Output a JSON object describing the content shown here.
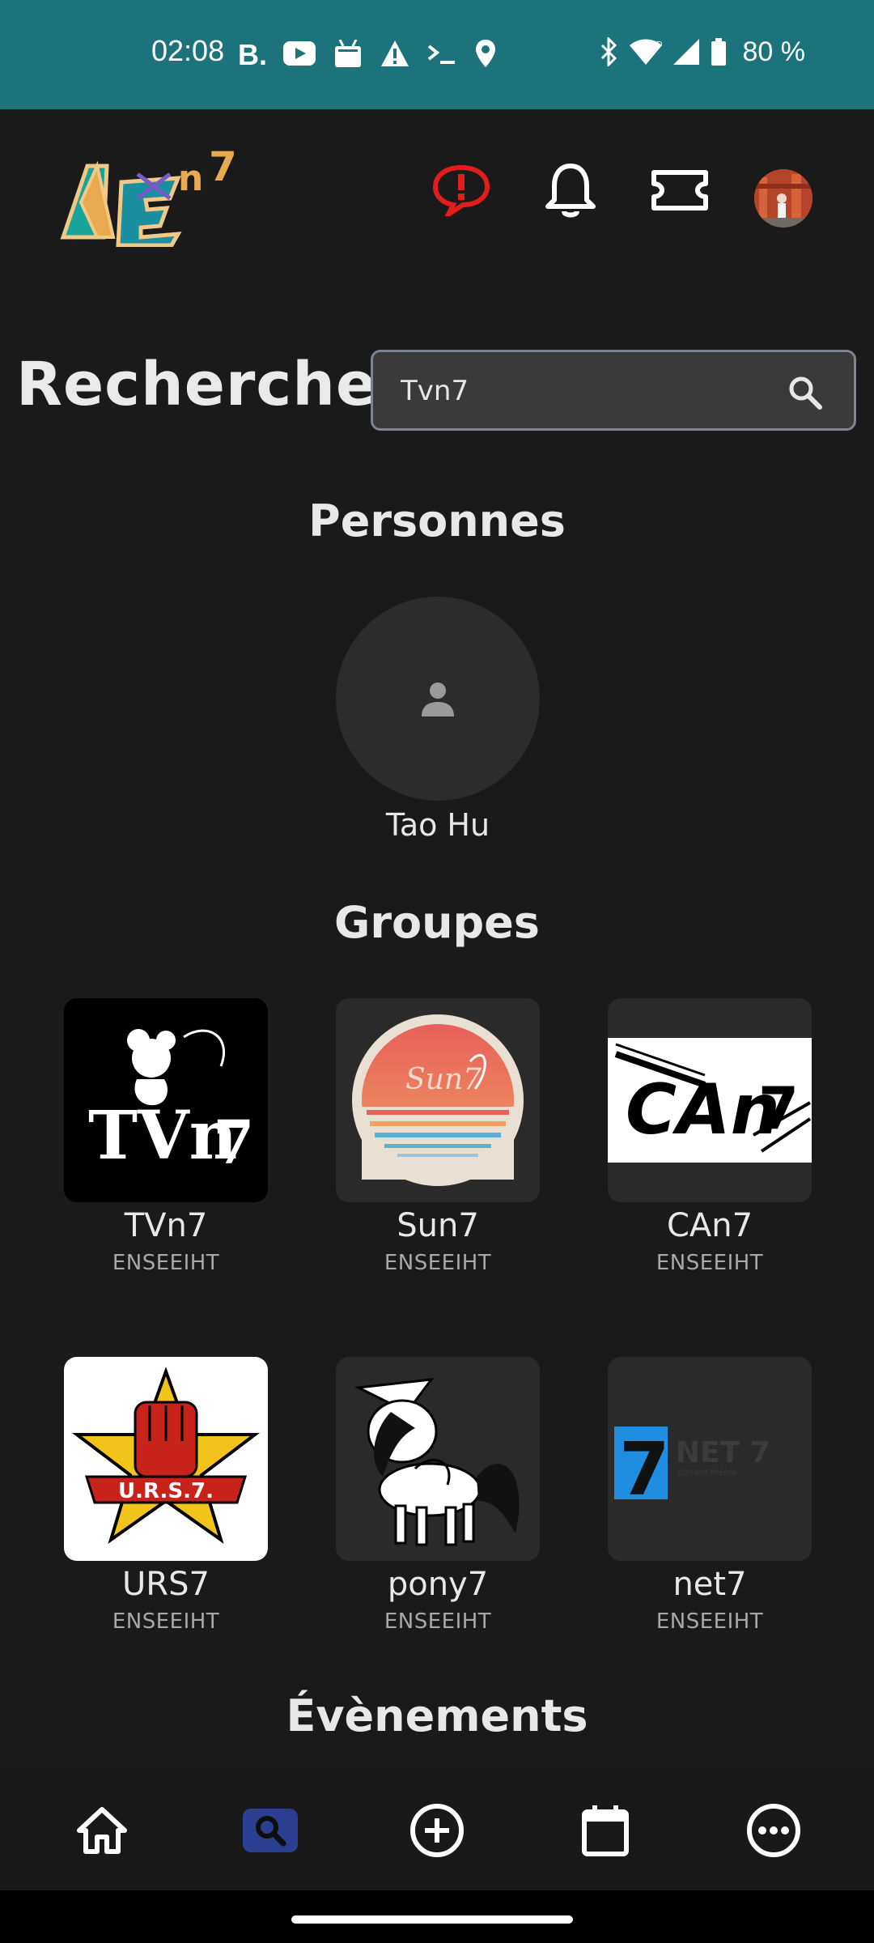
{
  "status_bar": {
    "time": "02:08",
    "battery_text": "80 %",
    "left_icons": [
      "booking-icon",
      "youtube-icon",
      "android-icon",
      "warning-icon",
      "terminal-icon",
      "location-icon"
    ],
    "right_icons": [
      "bluetooth-icon",
      "wifi-icon",
      "signal-icon",
      "battery-icon"
    ]
  },
  "header": {
    "logo_name": "AE n7 logo",
    "icons": [
      "report-icon",
      "bell-icon",
      "ticket-icon",
      "profile-avatar"
    ],
    "accent_report": "#e31c1c"
  },
  "page": {
    "title": "Recherche"
  },
  "search": {
    "value": "Tvn7",
    "placeholder": ""
  },
  "sections": {
    "people": "Personnes",
    "groups": "Groupes",
    "events": "Évènements"
  },
  "people": [
    {
      "name": "Tao Hu"
    }
  ],
  "groups": [
    {
      "name": "TVn7",
      "school": "ENSEEIHT"
    },
    {
      "name": "Sun7",
      "school": "ENSEEIHT"
    },
    {
      "name": "CAn7",
      "school": "ENSEEIHT"
    },
    {
      "name": "URS7",
      "school": "ENSEEIHT"
    },
    {
      "name": "pony7",
      "school": "ENSEEIHT"
    },
    {
      "name": "net7",
      "school": "ENSEEIHT"
    }
  ],
  "logo_texts": {
    "urs7_banner": "U.R.S.7.",
    "net7_brand": "NET 7",
    "net7_sub": "ÉDITION PRESSE",
    "net7_number": "7"
  },
  "nav": {
    "items": [
      "home-icon",
      "search-icon",
      "add-icon",
      "calendar-icon",
      "more-icon"
    ],
    "active_index": 1,
    "active_color": "#2a3f8f"
  }
}
